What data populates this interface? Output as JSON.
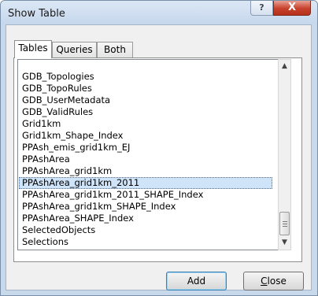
{
  "window": {
    "title": "Show Table",
    "help_label": "?",
    "close_label": "X"
  },
  "tabs": [
    {
      "label": "Tables",
      "active": true
    },
    {
      "label": "Queries",
      "active": false
    },
    {
      "label": "Both",
      "active": false
    }
  ],
  "list": {
    "items": [
      "GDB_Topologies",
      "GDB_TopoRules",
      "GDB_UserMetadata",
      "GDB_ValidRules",
      "Grid1km",
      "Grid1km_Shape_Index",
      "PPAsh_emis_grid1km_EJ",
      "PPAshArea",
      "PPAshArea_grid1km",
      "PPAshArea_grid1km_2011",
      "PPAshArea_grid1km_2011_SHAPE_Index",
      "PPAshArea_grid1km_SHAPE_Index",
      "PPAshArea_SHAPE_Index",
      "SelectedObjects",
      "Selections"
    ],
    "selected_item": "PPAshArea_grid1km_2011"
  },
  "scrollbar": {
    "up_arrow": "▲",
    "down_arrow": "▼"
  },
  "buttons": {
    "add_label": "Add",
    "close_first_letter": "C",
    "close_rest": "lose"
  }
}
